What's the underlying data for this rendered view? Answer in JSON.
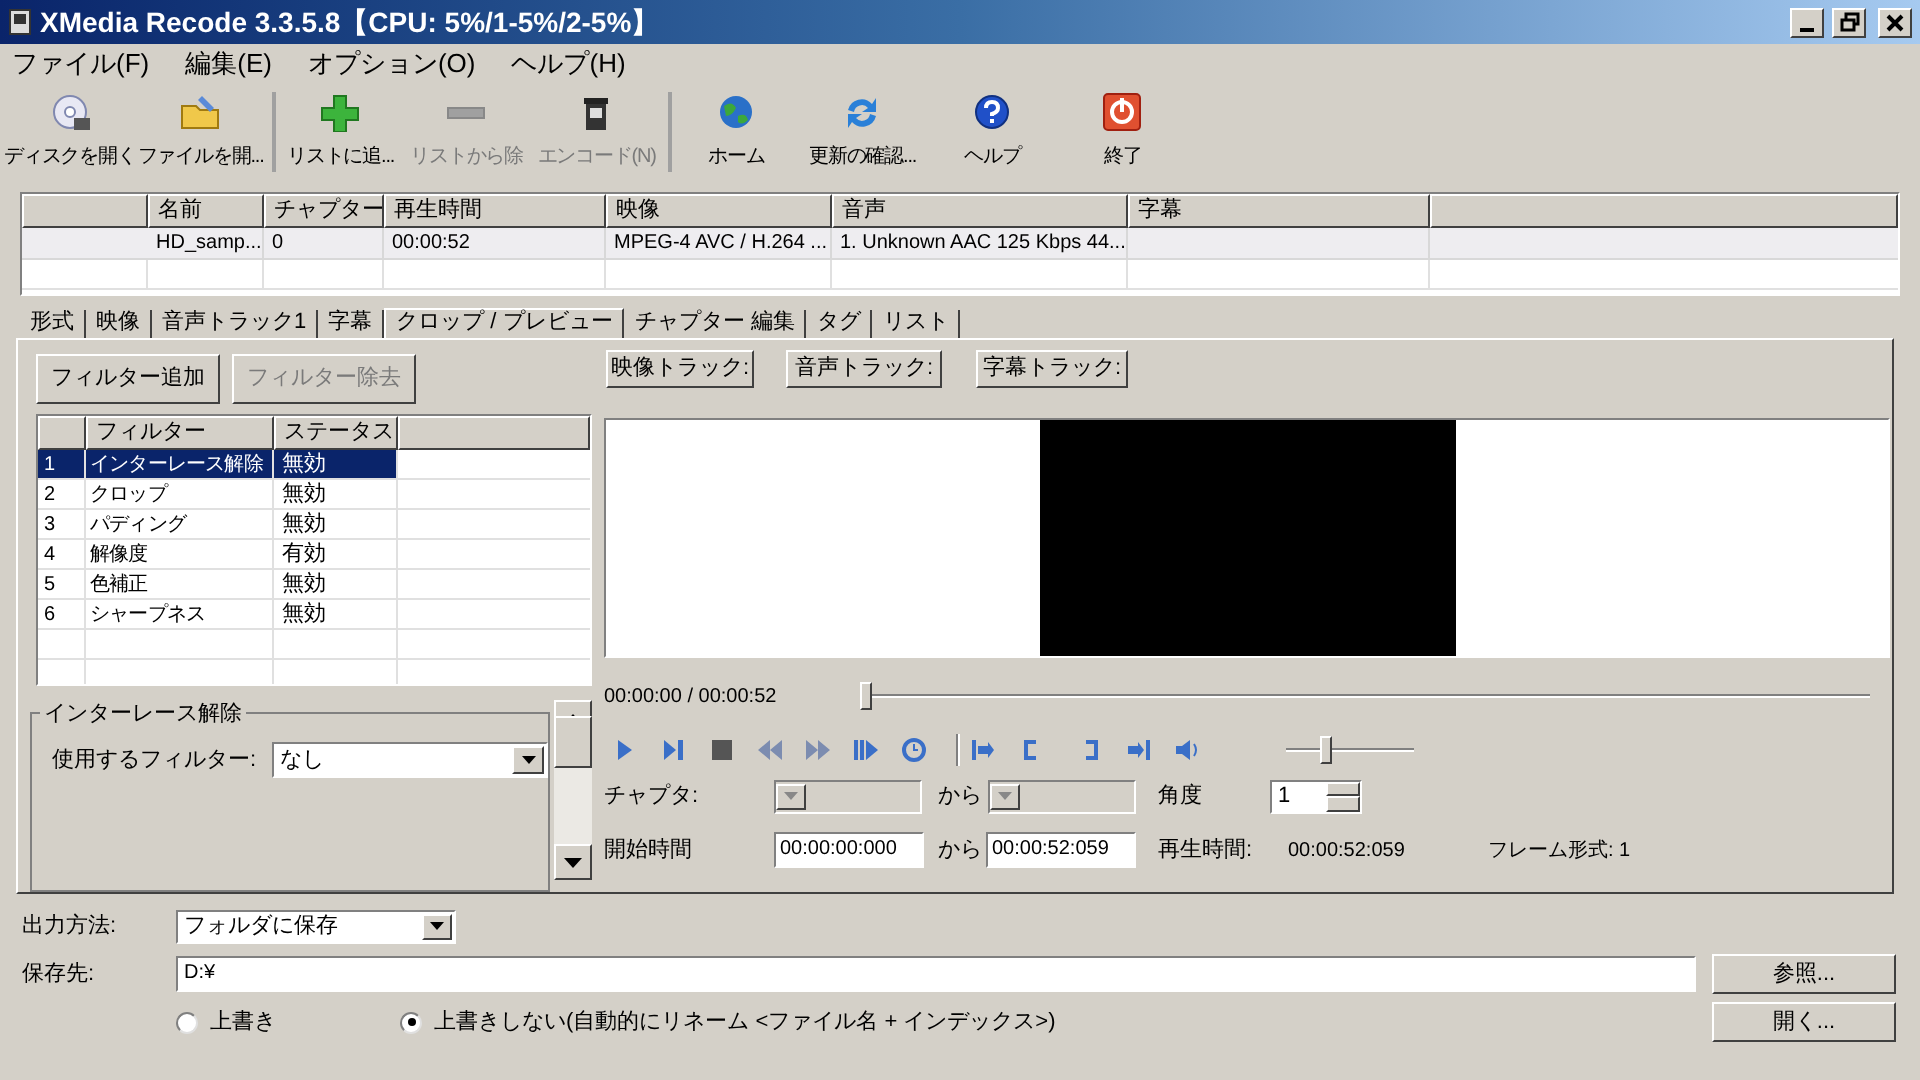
{
  "window": {
    "title": "XMedia Recode 3.3.5.8【CPU: 5%/1-5%/2-5%】"
  },
  "menu": [
    "ファイル(F)",
    "編集(E)",
    "オプション(O)",
    "ヘルプ(H)"
  ],
  "toolbar": [
    {
      "label": "ディスクを開く",
      "kind": "disc",
      "disabled": false,
      "separator_before": false
    },
    {
      "label": "ファイルを開...",
      "kind": "folder",
      "disabled": false,
      "separator_before": false
    },
    {
      "label": "リストに追...",
      "kind": "plus",
      "disabled": false,
      "separator_before": true
    },
    {
      "label": "リストから除",
      "kind": "minus",
      "disabled": true,
      "separator_before": false
    },
    {
      "label": "エンコード(N)",
      "kind": "encode",
      "disabled": true,
      "separator_before": false
    },
    {
      "label": "ホーム",
      "kind": "globe",
      "disabled": false,
      "separator_before": true
    },
    {
      "label": "更新の確認...",
      "kind": "refresh",
      "disabled": false,
      "separator_before": false
    },
    {
      "label": "ヘルプ",
      "kind": "help",
      "disabled": false,
      "separator_before": false
    },
    {
      "label": "終了",
      "kind": "power",
      "disabled": false,
      "separator_before": false
    }
  ],
  "file_list": {
    "columns": [
      "名前",
      "チャプター",
      "再生時間",
      "映像",
      "音声",
      "字幕"
    ],
    "rows": [
      {
        "cells": [
          "HD_samp...",
          "0",
          "00:00:52",
          "MPEG-4 AVC / H.264 ...",
          "1. Unknown AAC  125 Kbps 44..."
        ]
      }
    ]
  },
  "tabs": [
    {
      "label": "形式",
      "selected": false
    },
    {
      "label": "映像",
      "selected": false
    },
    {
      "label": "音声トラック1",
      "selected": false
    },
    {
      "label": "字幕",
      "selected": false
    },
    {
      "label": "クロップ / プレビュー",
      "selected": true
    },
    {
      "label": "チャプター 編集",
      "selected": false
    },
    {
      "label": "タグ",
      "selected": false
    },
    {
      "label": "リスト",
      "selected": false
    }
  ],
  "filters": {
    "buttons": [
      {
        "label": "フィルター追加",
        "disabled": false
      },
      {
        "label": "フィルター除去",
        "disabled": true
      }
    ],
    "columns": [
      "フィルター",
      "ステータス"
    ],
    "rows": [
      {
        "index": "1",
        "name": "インターレース解除",
        "status": "無効",
        "selected": true
      },
      {
        "index": "2",
        "name": "クロップ",
        "status": "無効",
        "selected": false
      },
      {
        "index": "3",
        "name": "パディング",
        "status": "無効",
        "selected": false
      },
      {
        "index": "4",
        "name": "解像度",
        "status": "有効",
        "selected": false
      },
      {
        "index": "5",
        "name": "色補正",
        "status": "無効",
        "selected": false
      },
      {
        "index": "6",
        "name": "シャープネス",
        "status": "無効",
        "selected": false
      }
    ]
  },
  "interlace_group": {
    "title": "インターレース解除",
    "filter_label": "使用するフィルター:",
    "filter_value": "なし"
  },
  "track_buttons": [
    "映像トラック:",
    "音声トラック:",
    "字幕トラック:"
  ],
  "player": {
    "time": "00:00:00 / 00:00:52",
    "seek": {
      "level": 0
    },
    "volume": {
      "level": 0.3
    }
  },
  "chapter": {
    "label": "チャプタ:",
    "from": "から",
    "disabled": true
  },
  "angle": {
    "label": "角度",
    "value": "1"
  },
  "times": {
    "start_label": "開始時間",
    "start": "00:00:00:000",
    "from": "から",
    "end": "00:00:52:059",
    "duration_label": "再生時間:",
    "duration": "00:00:52:059",
    "frame_label": "フレーム形式: 1"
  },
  "output": {
    "method_label": "出力方法:",
    "method": "フォルダに保存",
    "dest_label": "保存先:",
    "dest": "D:¥",
    "browse": "参照...",
    "open": "開く...",
    "radios": [
      {
        "label": "上書き",
        "selected": false
      },
      {
        "label": "上書きしない(自動的にリネーム <ファイル名 + インデックス>)",
        "selected": true
      }
    ]
  }
}
